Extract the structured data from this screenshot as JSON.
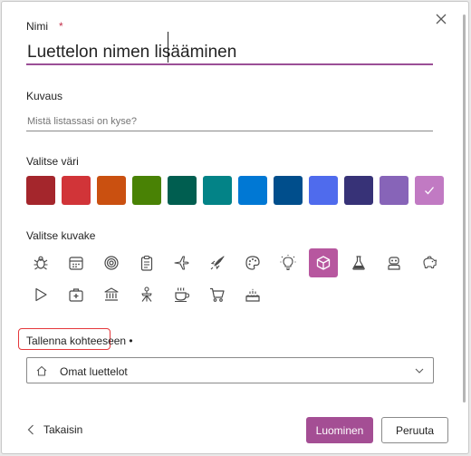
{
  "dialog": {
    "name_label": "Nimi",
    "required_mark": "*",
    "name_value": "Luettelon nimen lisääminen",
    "description_label": "Kuvaus",
    "description_value": "Mistä listassasi on kyse?",
    "color_label": "Valitse väri",
    "icon_label": "Valitse kuvake",
    "save_to_label": "Tallenna kohteeseen •",
    "location_value": "Omat luettelot",
    "back_label": "Takaisin",
    "create_label": "Luominen",
    "cancel_label": "Peruuta"
  },
  "colors": [
    {
      "name": "dark-red",
      "hex": "#a4262c"
    },
    {
      "name": "red",
      "hex": "#d13438"
    },
    {
      "name": "orange",
      "hex": "#ca5010"
    },
    {
      "name": "green",
      "hex": "#498205"
    },
    {
      "name": "dark-teal",
      "hex": "#005e50"
    },
    {
      "name": "teal",
      "hex": "#038387"
    },
    {
      "name": "blue",
      "hex": "#0078d4"
    },
    {
      "name": "dark-blue",
      "hex": "#004e8c"
    },
    {
      "name": "periwinkle",
      "hex": "#4f6bed"
    },
    {
      "name": "indigo",
      "hex": "#373277"
    },
    {
      "name": "purple",
      "hex": "#8764b8"
    },
    {
      "name": "orchid-selected",
      "hex": "#c17ac3"
    }
  ],
  "selected_color_index": 11,
  "icons": [
    "bug-icon",
    "calendar-icon",
    "target-icon",
    "clipboard-icon",
    "airplane-icon",
    "rocket-icon",
    "palette-icon",
    "lightbulb-icon",
    "cube-icon",
    "flask-icon",
    "robot-icon",
    "piggy-bank-icon",
    "play-triangle-icon",
    "first-aid-kit-icon",
    "bank-icon",
    "survey-stand-icon",
    "coffee-cup-icon",
    "shopping-cart-icon",
    "cake-icon"
  ],
  "selected_icon_index": 8,
  "accent": "#a44e94"
}
